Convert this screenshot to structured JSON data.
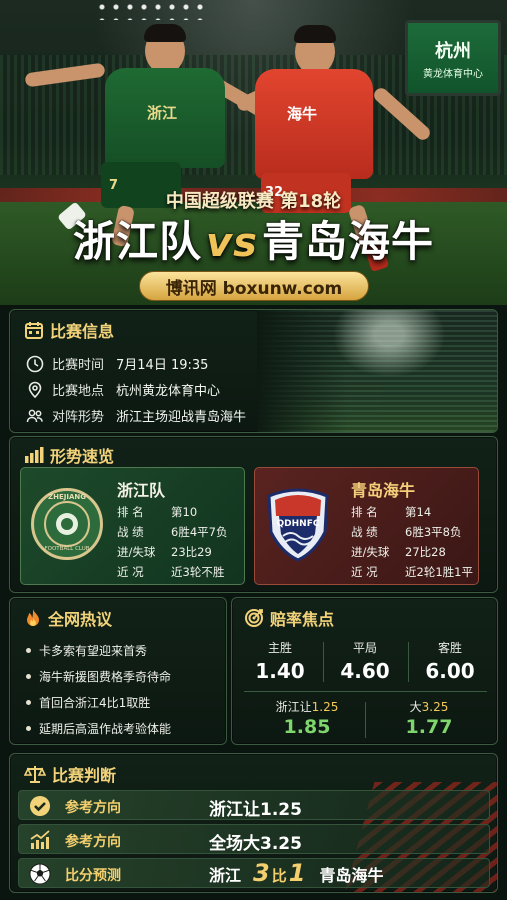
{
  "hero": {
    "scoreboard_city": "杭州",
    "scoreboard_venue": "黄龙体育中心",
    "player_left_jersey": "浙江",
    "player_left_number": "7",
    "player_right_jersey": "海牛",
    "player_right_number": "32",
    "subtitle": "中国超级联赛 第18轮",
    "home_team": "浙江队",
    "vs": "vs",
    "away_team": "青岛海牛",
    "site": "博讯网 boxunw.com"
  },
  "match_info": {
    "title": "比赛信息",
    "rows": [
      {
        "icon": "clock-icon",
        "label": "比赛时间",
        "value": "7月14日 19:35"
      },
      {
        "icon": "location-pin-icon",
        "label": "比赛地点",
        "value": "杭州黄龙体育中心"
      },
      {
        "icon": "people-icon",
        "label": "对阵形势",
        "value": "浙江主场迎战青岛海牛"
      }
    ]
  },
  "form": {
    "title": "形势速览",
    "home": {
      "name": "浙江队",
      "logo_top": "ZHEJIANG",
      "logo_bottom": "FOOTBALL CLUB",
      "stats": [
        {
          "k": "排 名",
          "v": "第10"
        },
        {
          "k": "战 绩",
          "v": "6胜4平7负"
        },
        {
          "k": "进/失球",
          "v": "23比29"
        },
        {
          "k": "近 况",
          "v": "近3轮不胜"
        }
      ]
    },
    "away": {
      "name": "青岛海牛",
      "logo_text": "QDHNFC",
      "stats": [
        {
          "k": "排 名",
          "v": "第14"
        },
        {
          "k": "战 绩",
          "v": "6胜3平8负"
        },
        {
          "k": "进/失球",
          "v": "27比28"
        },
        {
          "k": "近 况",
          "v": "近2轮1胜1平"
        }
      ]
    }
  },
  "hot": {
    "title": "全网热议",
    "items": [
      "卡多索有望迎来首秀",
      "海牛新援图费格季奇待命",
      "首回合浙江4比1取胜",
      "延期后高温作战考验体能"
    ]
  },
  "odds": {
    "title": "赔率焦点",
    "cols": [
      {
        "label": "主胜",
        "value": "1.40"
      },
      {
        "label": "平局",
        "value": "4.60"
      },
      {
        "label": "客胜",
        "value": "6.00"
      }
    ],
    "handicap": {
      "label": "浙江让",
      "line": "1.25",
      "value": "1.85"
    },
    "total": {
      "label": "大",
      "line": "3.25",
      "value": "1.77"
    }
  },
  "judge": {
    "title": "比赛判断",
    "rows": [
      {
        "label": "参考方向",
        "value": "浙江让1.25"
      },
      {
        "label": "参考方向",
        "value": "全场大3.25"
      },
      {
        "label": "比分预测"
      }
    ],
    "score": {
      "home": "浙江",
      "home_goals": "3",
      "sep": "比",
      "away_goals": "1",
      "away": "青岛海牛"
    }
  },
  "colors": {
    "gold": "#f3d37a",
    "green_value": "#7fd66c",
    "panel_border": "#3b5a3f"
  }
}
